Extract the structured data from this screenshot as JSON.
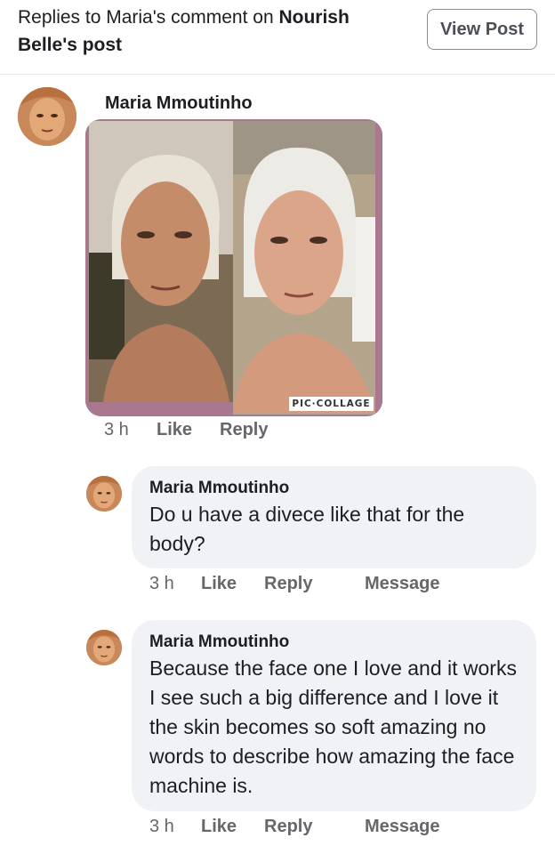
{
  "header": {
    "title_prefix": "Replies to Maria's comment on ",
    "page_name_part1": "Nourish",
    "page_name_part2": "Belle",
    "title_suffix": "'s post",
    "view_post_label": "View Post"
  },
  "post": {
    "author": "Maria Mmoutinho",
    "photo_watermark": "PIC·COLLAGE",
    "time": "3 h",
    "like_label": "Like",
    "reply_label": "Reply"
  },
  "replies": [
    {
      "author": "Maria Mmoutinho",
      "text": "Do u have a divece like that for the body?",
      "time": "3 h",
      "like_label": "Like",
      "reply_label": "Reply",
      "message_label": "Message"
    },
    {
      "author": "Maria Mmoutinho",
      "text": "Because the face one I love and it works I see such a big difference and I love it the skin becomes so soft amazing no words to describe how amazing the face machine is.",
      "time": "3 h",
      "like_label": "Like",
      "reply_label": "Reply",
      "message_label": "Message"
    }
  ],
  "colors": {
    "bubble_bg": "#f0f2f5",
    "secondary_text": "#65676b",
    "collage_frame": "#a9788f"
  }
}
